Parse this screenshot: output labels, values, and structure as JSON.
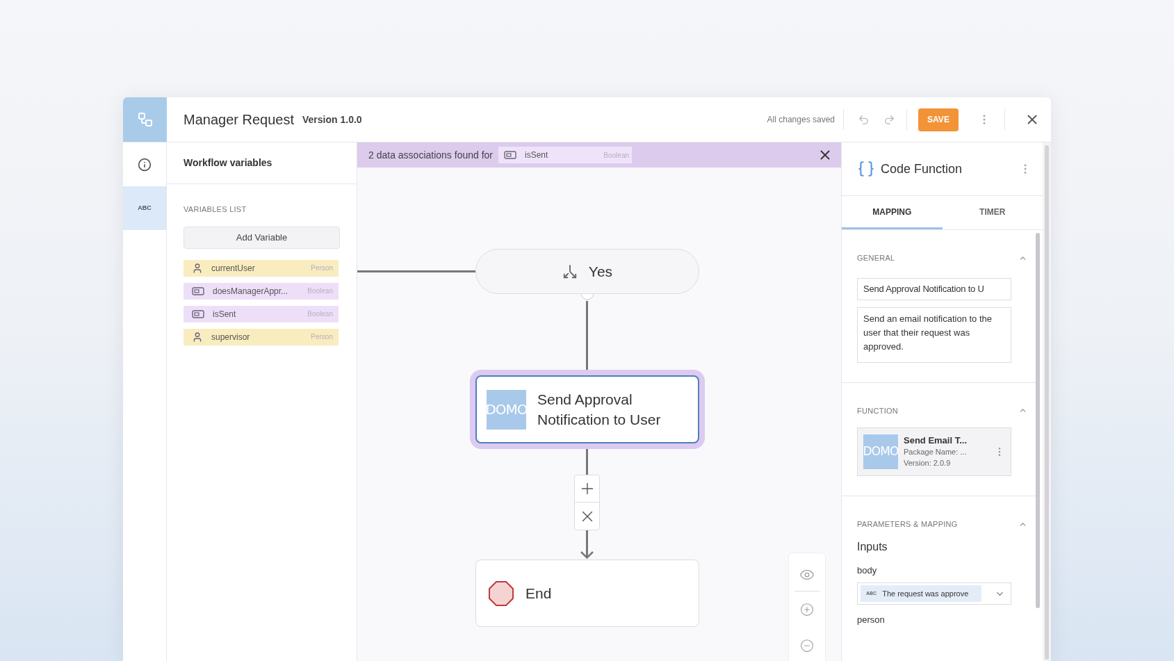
{
  "header": {
    "title": "Manager Request",
    "version": "Version 1.0.0",
    "save_status": "All changes saved",
    "save_button": "SAVE"
  },
  "rail": [
    {
      "kind": "info",
      "selected": false
    },
    {
      "kind": "variables",
      "label": "ABC",
      "selected": true
    }
  ],
  "variables_panel": {
    "title": "Workflow variables",
    "section": "VARIABLES LIST",
    "add_button": "Add Variable",
    "variables": [
      {
        "name": "currentUser",
        "type": "Person",
        "kind": "person"
      },
      {
        "name": "doesManagerAppr...",
        "type": "Boolean",
        "kind": "boolean"
      },
      {
        "name": "isSent",
        "type": "Boolean",
        "kind": "boolean"
      },
      {
        "name": "supervisor",
        "type": "Person",
        "kind": "person"
      }
    ]
  },
  "banner": {
    "text": "2 data associations found for",
    "variable": {
      "name": "isSent",
      "type": "Boolean",
      "kind": "boolean"
    }
  },
  "canvas": {
    "nodes": [
      {
        "kind": "branch",
        "label": "Yes",
        "selected": false
      },
      {
        "kind": "action",
        "label": "Send Approval Notification to User",
        "logo": "DOMO",
        "selected": true
      },
      {
        "kind": "end",
        "label": "End",
        "selected": false
      }
    ]
  },
  "properties": {
    "title": "Code Function",
    "tabs": [
      {
        "label": "MAPPING",
        "selected": true
      },
      {
        "label": "TIMER",
        "selected": false
      }
    ],
    "sections": [
      {
        "kind": "general",
        "title": "GENERAL",
        "expanded": true,
        "name_value": "Send Approval Notification to U",
        "description_value": "Send an email notification to the user that their request was approved."
      },
      {
        "kind": "function",
        "title": "FUNCTION",
        "expanded": true,
        "function": {
          "logo": "DOMO",
          "name": "Send Email T...",
          "package": "Package Name: ...",
          "version": "Version: 2.0.9"
        }
      },
      {
        "kind": "parameters",
        "title": "PARAMETERS & MAPPING",
        "expanded": true,
        "subtitle": "Inputs",
        "inputs": [
          {
            "label": "body",
            "tag": "ABC",
            "value": "The request was approve"
          },
          {
            "label": "person"
          }
        ]
      }
    ]
  }
}
